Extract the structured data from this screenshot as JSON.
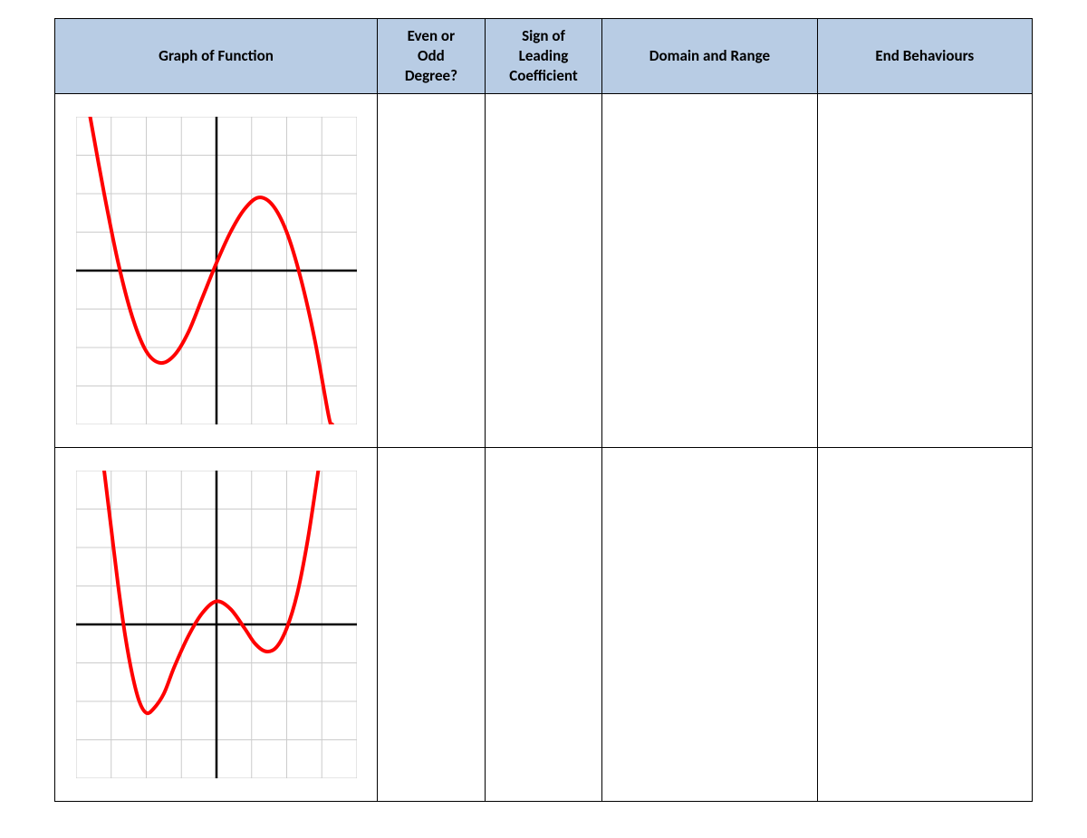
{
  "headers": {
    "graph": "Graph of Function",
    "degree": "Even or\nOdd\nDegree?",
    "sign": "Sign of\nLeading\nCoefficient",
    "domain": "Domain and  Range",
    "end": "End Behaviours"
  },
  "rows": [
    {
      "degree": "",
      "sign": "",
      "domain": "",
      "end": "",
      "chart_data": {
        "type": "line",
        "description": "Cubic-like curve: descends from top-left, reaches a local minimum in the third quadrant, rises to a local maximum in the first quadrant, then descends toward bottom-right.",
        "x_range": [
          -4,
          4
        ],
        "y_range": [
          -4,
          4
        ],
        "grid": true,
        "axes": true,
        "curve_color": "#ff0000",
        "curve_points": [
          [
            -3.6,
            4.0
          ],
          [
            -3.2,
            2.0
          ],
          [
            -2.8,
            0.2
          ],
          [
            -2.4,
            -1.2
          ],
          [
            -2.0,
            -2.1
          ],
          [
            -1.6,
            -2.4
          ],
          [
            -1.2,
            -2.2
          ],
          [
            -0.8,
            -1.6
          ],
          [
            -0.4,
            -0.7
          ],
          [
            0.0,
            0.2
          ],
          [
            0.4,
            1.0
          ],
          [
            0.8,
            1.6
          ],
          [
            1.2,
            1.9
          ],
          [
            1.6,
            1.7
          ],
          [
            2.0,
            1.0
          ],
          [
            2.4,
            -0.2
          ],
          [
            2.8,
            -1.8
          ],
          [
            3.2,
            -3.8
          ],
          [
            3.3,
            -4.0
          ]
        ]
      }
    },
    {
      "degree": "",
      "sign": "",
      "domain": "",
      "end": "",
      "chart_data": {
        "type": "line",
        "description": "Quartic-like (W-shaped) curve: both ends rise to +infinity; two local minima below the x-axis and a local maximum near x≈0 slightly above the x-axis.",
        "x_range": [
          -4,
          4
        ],
        "y_range": [
          -4,
          4
        ],
        "grid": true,
        "axes": true,
        "curve_color": "#ff0000",
        "curve_points": [
          [
            -3.2,
            4.0
          ],
          [
            -3.0,
            2.5
          ],
          [
            -2.8,
            1.0
          ],
          [
            -2.6,
            -0.3
          ],
          [
            -2.4,
            -1.3
          ],
          [
            -2.2,
            -2.0
          ],
          [
            -2.0,
            -2.3
          ],
          [
            -1.8,
            -2.2
          ],
          [
            -1.5,
            -1.8
          ],
          [
            -1.2,
            -1.1
          ],
          [
            -0.8,
            -0.3
          ],
          [
            -0.4,
            0.3
          ],
          [
            0.0,
            0.6
          ],
          [
            0.4,
            0.4
          ],
          [
            0.8,
            -0.1
          ],
          [
            1.1,
            -0.5
          ],
          [
            1.4,
            -0.7
          ],
          [
            1.7,
            -0.6
          ],
          [
            2.0,
            -0.1
          ],
          [
            2.3,
            0.8
          ],
          [
            2.6,
            2.2
          ],
          [
            2.9,
            4.0
          ]
        ]
      }
    }
  ]
}
